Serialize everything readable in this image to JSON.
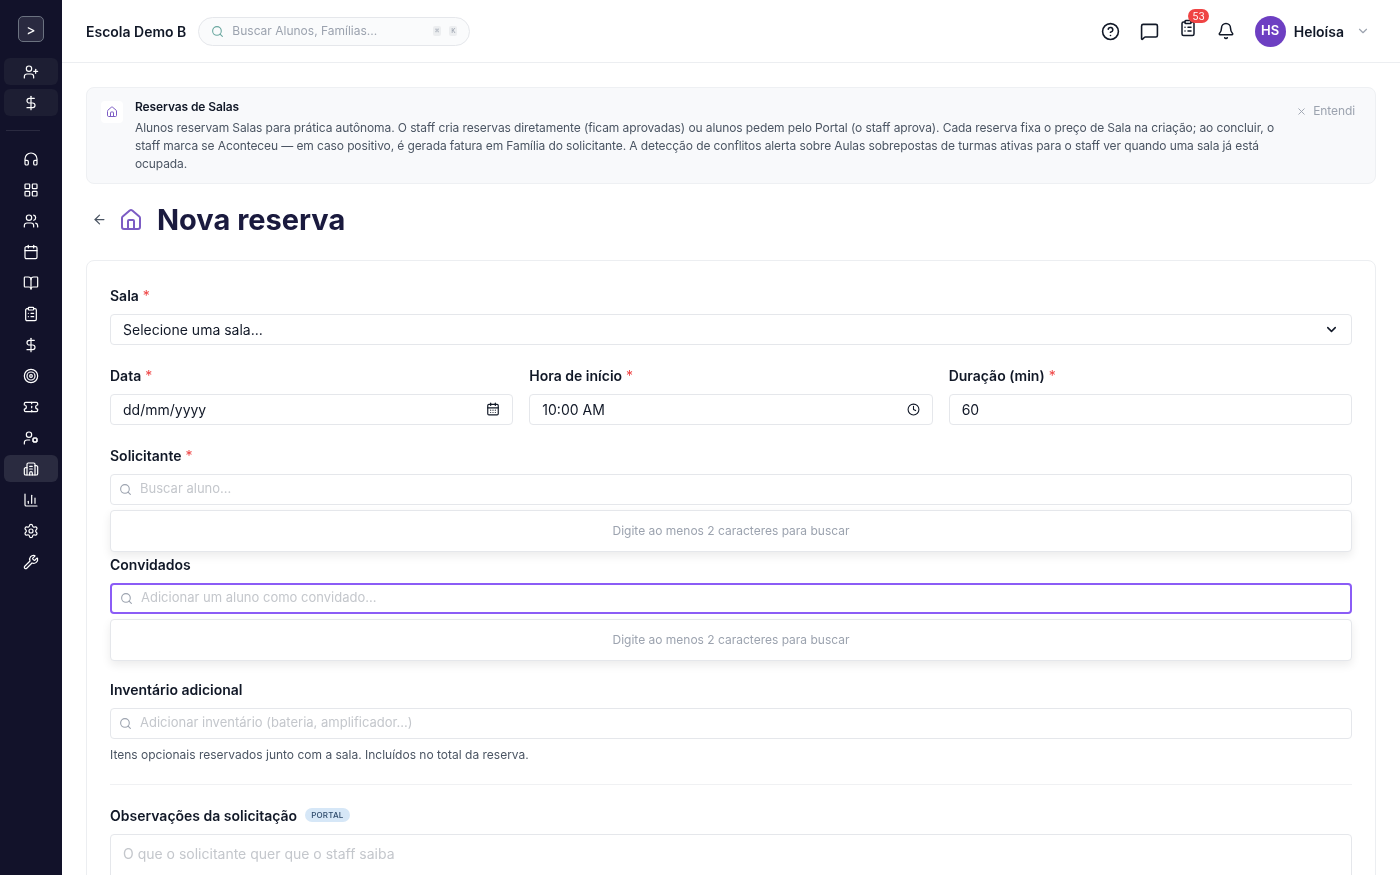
{
  "sidebar": {
    "toggle": ">",
    "items": [
      {
        "kind": "quick",
        "selected": false
      },
      {
        "kind": "quick",
        "selected": false
      },
      {
        "kind": "nav",
        "selected": false
      },
      {
        "kind": "nav",
        "selected": false
      },
      {
        "kind": "nav",
        "selected": false
      },
      {
        "kind": "nav",
        "selected": false
      },
      {
        "kind": "nav",
        "selected": false
      },
      {
        "kind": "nav",
        "selected": false
      },
      {
        "kind": "nav",
        "selected": false
      },
      {
        "kind": "nav",
        "selected": false
      },
      {
        "kind": "nav",
        "selected": false
      },
      {
        "kind": "nav",
        "selected": false
      },
      {
        "kind": "nav",
        "selected": true
      },
      {
        "kind": "nav",
        "selected": false
      },
      {
        "kind": "nav",
        "selected": false
      },
      {
        "kind": "nav",
        "selected": false
      }
    ]
  },
  "header": {
    "school": "Escola Demo B",
    "search": {
      "placeholder": "Buscar Alunos, Famílias...",
      "keys": [
        "⌘",
        "K"
      ]
    },
    "tasks_badge": "53",
    "user": {
      "initials": "HS",
      "name": "Heloísa"
    }
  },
  "info_banner": {
    "title": "Reservas de Salas",
    "text": "Alunos reservam Salas para prática autônoma. O staff cria reservas diretamente (ficam aprovadas) ou alunos pedem pelo Portal (o staff aprova). Cada reserva fixa o preço de Sala na criação; ao concluir, o staff marca se Aconteceu — em caso positivo, é gerada fatura em Família do solicitante. A detecção de conflitos alerta sobre Aulas sobrepostas de turmas ativas para o staff ver quando uma sala já está ocupada.",
    "dismiss": "Entendi"
  },
  "page_title": "Nova reserva",
  "form": {
    "room": {
      "label": "Sala",
      "required_mark": "*",
      "value": "Selecione uma sala..."
    },
    "date": {
      "label": "Data",
      "required_mark": "*",
      "value": "dd/mm/yyyy"
    },
    "start": {
      "label": "Hora de início",
      "required_mark": "*",
      "value": "10:00 AM"
    },
    "duration": {
      "label": "Duração (min)",
      "required_mark": "*",
      "value": "60"
    },
    "requester": {
      "label": "Solicitante",
      "required_mark": "*",
      "placeholder": "Buscar aluno...",
      "focused": false,
      "hint": "Digite ao menos 2 caracteres para buscar"
    },
    "guests": {
      "label": "Convidados",
      "placeholder": "Adicionar um aluno como convidado...",
      "focused": true,
      "hint": "Digite ao menos 2 caracteres para buscar"
    },
    "inventory": {
      "label": "Inventário adicional",
      "placeholder": "Adicionar inventário (bateria, amplificador...)",
      "help": "Itens opcionais reservados junto com a sala. Incluídos no total da reserva."
    },
    "notes": {
      "label": "Observações da solicitação",
      "badge": "PORTAL",
      "placeholder": "O que o solicitante quer que o staff saiba"
    }
  }
}
